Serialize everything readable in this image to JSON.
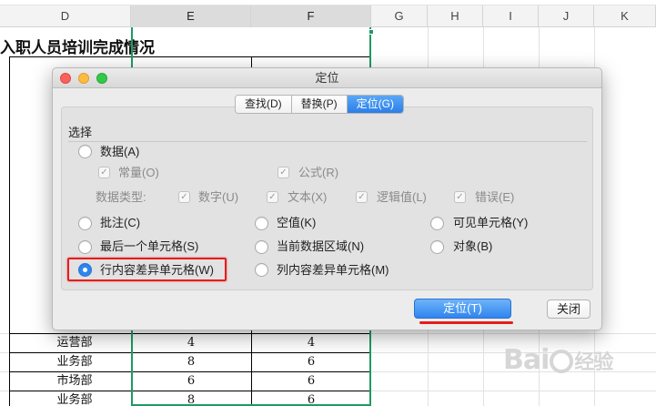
{
  "sheet": {
    "columns": [
      "D",
      "E",
      "F",
      "G",
      "H",
      "I",
      "J",
      "K"
    ],
    "title": "入职人员培训完成情况",
    "rows": [
      {
        "dept": "运营部",
        "e": "4",
        "f": "4"
      },
      {
        "dept": "业务部",
        "e": "8",
        "f": "6"
      },
      {
        "dept": "市场部",
        "e": "6",
        "f": "6"
      },
      {
        "dept": "业务部",
        "e": "8",
        "f": "6"
      }
    ]
  },
  "dialog": {
    "title": "定位",
    "tabs": [
      {
        "label": "查找(D)",
        "active": false
      },
      {
        "label": "替换(P)",
        "active": false
      },
      {
        "label": "定位(G)",
        "active": true
      }
    ],
    "group_label": "选择",
    "options": {
      "data": "数据(A)",
      "constant": "常量(O)",
      "formula": "公式(R)",
      "data_type_label": "数据类型:",
      "number": "数字(U)",
      "text": "文本(X)",
      "logical": "逻辑值(L)",
      "error": "错误(E)",
      "comment": "批注(C)",
      "blank": "空值(K)",
      "visible_cells": "可见单元格(Y)",
      "last_cell": "最后一个单元格(S)",
      "current_region": "当前数据区域(N)",
      "objects": "对象(B)",
      "row_diff": "行内容差异单元格(W)",
      "col_diff": "列内容差异单元格(M)"
    },
    "selected_option": "row_diff",
    "buttons": {
      "locate": "定位(T)",
      "close": "关闭"
    }
  },
  "colors": {
    "accent": "#2f86ef",
    "selection": "#1f9a64",
    "highlight": "#e61c1c"
  },
  "watermark": {
    "brand": "Bai",
    "suffix": "经验"
  }
}
